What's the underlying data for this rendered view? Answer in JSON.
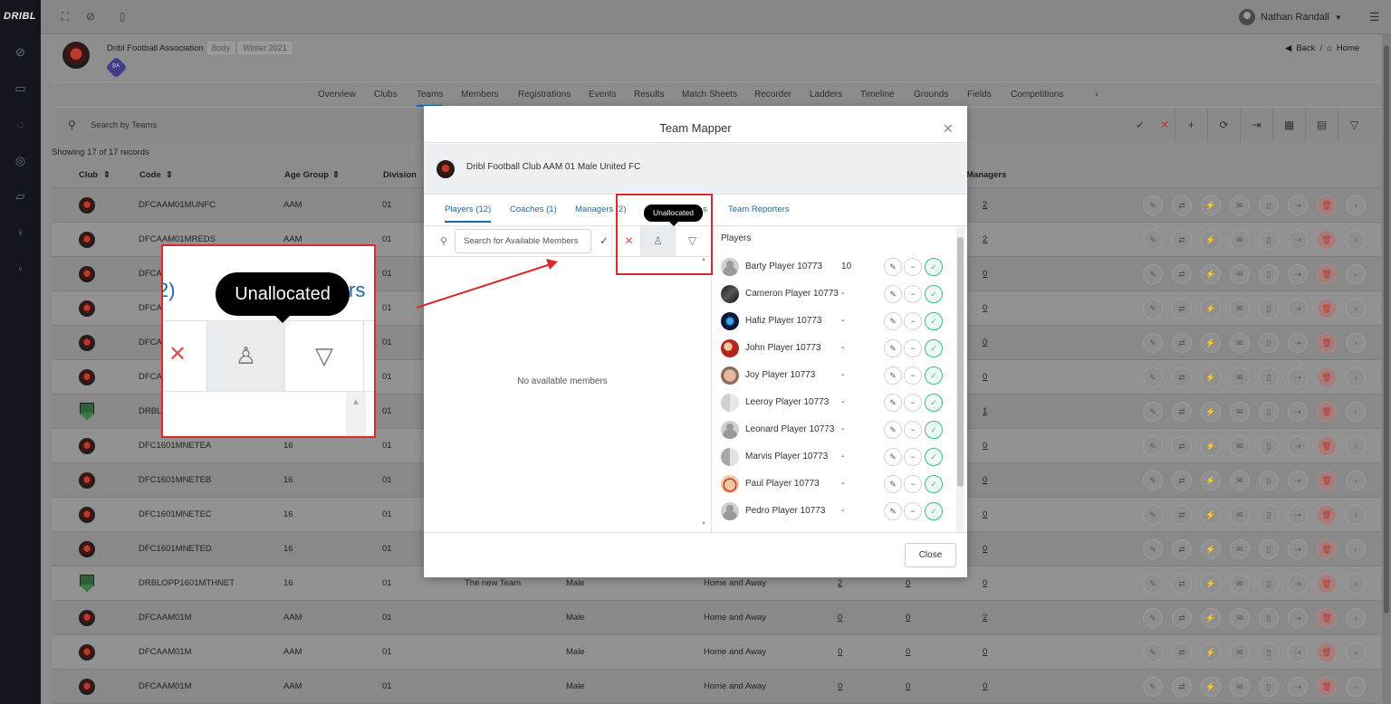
{
  "app": {
    "logo": "DRIBL"
  },
  "topbar": {
    "user_name": "Nathan Randall"
  },
  "association": {
    "name": "Dribl Football Association",
    "type_tag": "Body",
    "season_tag": "Winter 2021",
    "badge_text": "BA",
    "back_label": "Back",
    "separator": "/",
    "home_label": "Home"
  },
  "nav_tabs": [
    "Overview",
    "Clubs",
    "Teams",
    "Members",
    "Registrations",
    "Events",
    "Results",
    "Match Sheets",
    "Recorder",
    "Ladders",
    "Timeline",
    "Grounds",
    "Fields",
    "Competitions"
  ],
  "search": {
    "placeholder": "Search by Teams"
  },
  "records_text": "Showing 17 of 17 records",
  "table": {
    "headers": {
      "club": "Club",
      "code": "Code",
      "age_group": "Age Group",
      "division": "Division",
      "managers": "Managers"
    },
    "rows": [
      {
        "code": "DFCAAM01MUNFC",
        "age": "AAM",
        "div": "01",
        "team": "",
        "gender": "",
        "format": "",
        "c1": "",
        "c2": "",
        "mgr": "2"
      },
      {
        "code": "DFCAAM01MREDS",
        "age": "AAM",
        "div": "01",
        "team": "",
        "gender": "",
        "format": "",
        "c1": "",
        "c2": "",
        "mgr": "2"
      },
      {
        "code": "DFCA",
        "age": "",
        "div": "01",
        "team": "",
        "gender": "",
        "format": "",
        "c1": "",
        "c2": "",
        "mgr": "0"
      },
      {
        "code": "DFCA",
        "age": "",
        "div": "01",
        "team": "",
        "gender": "",
        "format": "",
        "c1": "",
        "c2": "",
        "mgr": "0"
      },
      {
        "code": "DFCA",
        "age": "",
        "div": "01",
        "team": "",
        "gender": "",
        "format": "",
        "c1": "",
        "c2": "",
        "mgr": "0"
      },
      {
        "code": "DFCA",
        "age": "",
        "div": "01",
        "team": "",
        "gender": "",
        "format": "",
        "c1": "",
        "c2": "",
        "mgr": "0"
      },
      {
        "code": "DRBL",
        "age": "",
        "div": "01",
        "team": "",
        "gender": "",
        "format": "",
        "c1": "",
        "c2": "",
        "mgr": "1"
      },
      {
        "code": "DFC1601MNETEA",
        "age": "16",
        "div": "01",
        "team": "",
        "gender": "",
        "format": "",
        "c1": "",
        "c2": "",
        "mgr": "0"
      },
      {
        "code": "DFC1601MNETEB",
        "age": "16",
        "div": "01",
        "team": "",
        "gender": "",
        "format": "",
        "c1": "",
        "c2": "",
        "mgr": "0"
      },
      {
        "code": "DFC1601MNETEC",
        "age": "16",
        "div": "01",
        "team": "",
        "gender": "",
        "format": "",
        "c1": "",
        "c2": "",
        "mgr": "0"
      },
      {
        "code": "DFC1601MNETED",
        "age": "16",
        "div": "01",
        "team": "",
        "gender": "",
        "format": "",
        "c1": "",
        "c2": "",
        "mgr": "0"
      },
      {
        "code": "DRBLOPP1601MTHNET",
        "age": "16",
        "div": "01",
        "team": "The new Team",
        "gender": "Male",
        "format": "Home and Away",
        "c1": "2",
        "c2": "0",
        "mgr": "0"
      },
      {
        "code": "DFCAAM01M",
        "age": "AAM",
        "div": "01",
        "team": "",
        "gender": "Male",
        "format": "Home and Away",
        "c1": "0",
        "c2": "0",
        "mgr": "2"
      },
      {
        "code": "DFCAAM01M",
        "age": "AAM",
        "div": "01",
        "team": "",
        "gender": "Male",
        "format": "Home and Away",
        "c1": "0",
        "c2": "0",
        "mgr": "0"
      },
      {
        "code": "DFCAAM01M",
        "age": "AAM",
        "div": "01",
        "team": "",
        "gender": "Male",
        "format": "Home and Away",
        "c1": "0",
        "c2": "0",
        "mgr": "0"
      }
    ]
  },
  "modal": {
    "title": "Team Mapper",
    "team_name": "Dribl Football Club AAM 01 Male United FC",
    "tabs": [
      "Players (12)",
      "Coaches (1)",
      "Managers (2)",
      "s",
      "Team Reporters"
    ],
    "search_placeholder": "Search for Available Members",
    "empty_text": "No available members",
    "players_title": "Players",
    "players": [
      {
        "name": "Barty Player 10773",
        "num": "10",
        "avatar": "default"
      },
      {
        "name": "Cameron Player 10773",
        "num": "-",
        "avatar": "photo-dark"
      },
      {
        "name": "Hafiz Player 10773",
        "num": "-",
        "avatar": "photo-blue"
      },
      {
        "name": "John Player 10773",
        "num": "-",
        "avatar": "photo-red"
      },
      {
        "name": "Joy Player 10773",
        "num": "-",
        "avatar": "photo-face"
      },
      {
        "name": "Leeroy Player 10773",
        "num": "-",
        "avatar": "shield"
      },
      {
        "name": "Leonard Player 10773",
        "num": "-",
        "avatar": "default"
      },
      {
        "name": "Marvis Player 10773",
        "num": "-",
        "avatar": "half"
      },
      {
        "name": "Paul Player 10773",
        "num": "-",
        "avatar": "cartoon"
      },
      {
        "name": "Pedro Player 10773",
        "num": "-",
        "avatar": "default"
      }
    ],
    "close_label": "Close"
  },
  "tooltip": {
    "text": "Unallocated"
  },
  "zoom": {
    "left_fragment": "2)",
    "right_fragment": "rs"
  },
  "colors": {
    "accent": "#1a6ab0",
    "danger": "#d9534f",
    "success": "#3cbd7c",
    "highlight": "#d92b2b"
  }
}
